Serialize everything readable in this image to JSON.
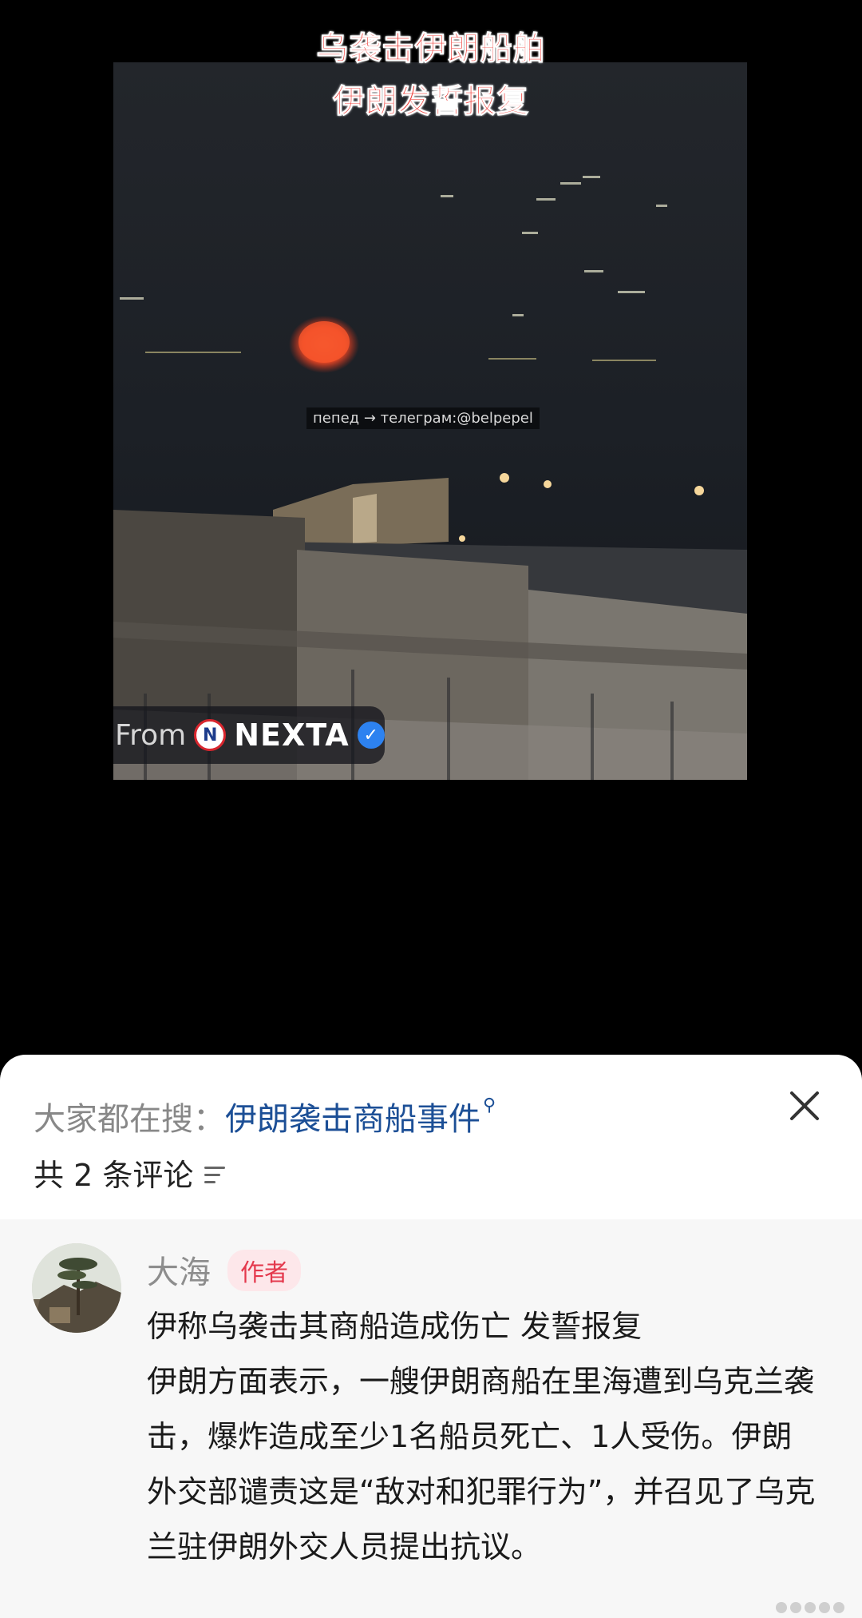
{
  "video": {
    "title_line1": "乌袭击伊朗船舶",
    "title_line2": "伊朗发誓报复",
    "watermark": "пепед → телеграм:@belpepel",
    "source_from": "From",
    "source_logo_letter": "N",
    "source_name": "NEXTA",
    "verified_glyph": "✓"
  },
  "sheet": {
    "search_prefix": "大家都在搜：",
    "search_term": "伊朗袭击商船事件",
    "search_icon_glyph": "⚲",
    "comment_count_label": "共 2 条评论"
  },
  "comment": {
    "author": "大海",
    "author_badge": "作者",
    "title": "伊称乌袭击其商船造成伤亡 发誓报复",
    "body": "伊朗方面表示，一艘伊朗商船在里海遭到乌克兰袭击，爆炸造成至少1名船员死亡、1人受伤。伊朗外交部谴责这是“敌对和犯罪行为”，并召见了乌克兰驻伊朗外交人员提出抗议。"
  },
  "colors": {
    "title_red": "#ee3b36",
    "link_blue": "#1c4f96",
    "badge_red": "#e4394d",
    "badge_bg": "#fde7ea"
  },
  "icons": [
    "close-icon",
    "sort-icon",
    "search-icon",
    "verified-icon",
    "nexta-logo-icon"
  ]
}
